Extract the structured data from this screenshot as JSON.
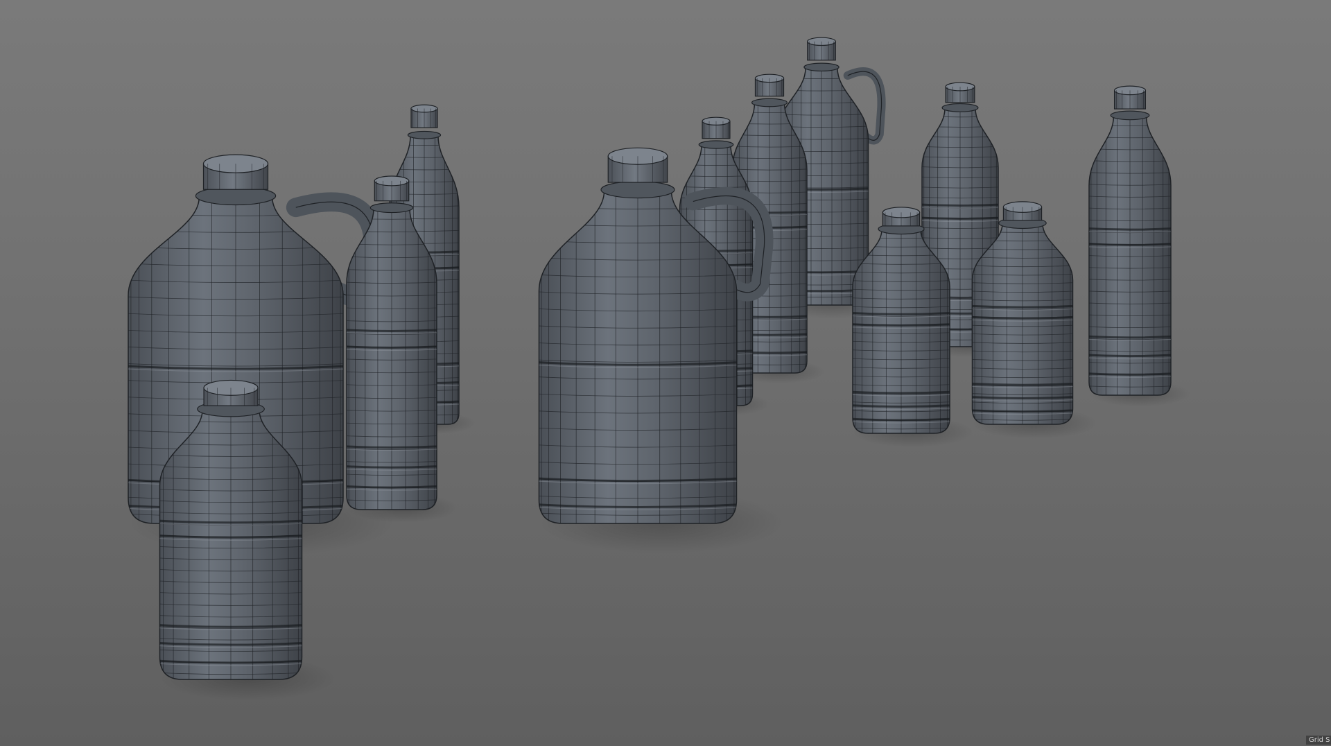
{
  "viewport": {
    "status_text": "Grid S",
    "colors": {
      "background_top": "#7a7a7a",
      "background_bottom": "#5f5f5f",
      "model_fill": "#5b6169",
      "model_highlight": "#8a9099",
      "wire": "#1f2226"
    }
  },
  "models": [
    {
      "name": "jug-large-left",
      "kind": "jug"
    },
    {
      "name": "bottle-back-left",
      "kind": "bottle"
    },
    {
      "name": "bottle-mid-left",
      "kind": "bottle"
    },
    {
      "name": "bottle-front-left",
      "kind": "bottle-short"
    },
    {
      "name": "jug-center",
      "kind": "jug"
    },
    {
      "name": "bottle-center-back",
      "kind": "bottle"
    },
    {
      "name": "bottle-center-right",
      "kind": "bottle"
    },
    {
      "name": "jug-back-right",
      "kind": "jug"
    },
    {
      "name": "bottle-right-tall",
      "kind": "bottle"
    },
    {
      "name": "bottle-right-short-a",
      "kind": "bottle-short"
    },
    {
      "name": "bottle-right-short-b",
      "kind": "bottle-short"
    },
    {
      "name": "bottle-far-right",
      "kind": "bottle"
    }
  ]
}
